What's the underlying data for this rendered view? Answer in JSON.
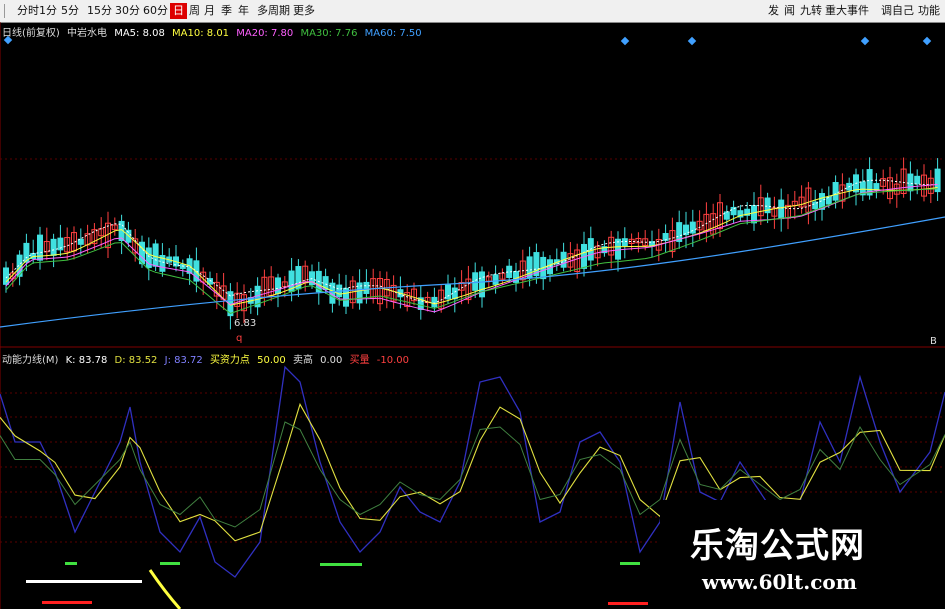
{
  "toolbar": {
    "periods": [
      "分时",
      "1分",
      "5分",
      "15分",
      "30分",
      "60分",
      "日",
      "周",
      "月",
      "季",
      "年",
      "多周期",
      "更多"
    ],
    "active_period": "日",
    "right_buttons": [
      "发",
      "闻",
      "九转",
      "重大事件",
      "调自己",
      "功能"
    ]
  },
  "main_legend": {
    "indicator": "日线(前复权)",
    "stock": "中岩水电",
    "ma5": "MA5: 8.08",
    "ma10": "MA10: 8.01",
    "ma20": "MA20: 7.80",
    "ma30": "MA30: 7.76",
    "ma60": "MA60: 7.50"
  },
  "price_low_label": "6.83",
  "price_low_marker": "q",
  "axis_tag_right": "B",
  "sub_legend": {
    "indicator": "动能力线(M)",
    "k": "K: 83.78",
    "d": "D: 83.52",
    "j": "J: 83.72",
    "buy": "买资力点",
    "buy_val": "50.00",
    "sell": "卖高",
    "sell_val": "0.00",
    "line": "买量",
    "line_val": "-10.00"
  },
  "watermark": {
    "title": "乐淘公式网",
    "url": "www.60lt.com"
  },
  "colors": {
    "up": "#ff4040",
    "down": "#40e0e0",
    "ma5": "#ffffff",
    "ma10": "#ffff40",
    "ma20": "#ff60ff",
    "ma30": "#40c040",
    "ma60": "#40a0ff",
    "k": "#3030c0",
    "d": "#e0e040",
    "j": "#408040"
  },
  "icons": [
    "diamond-marker-icon"
  ]
}
